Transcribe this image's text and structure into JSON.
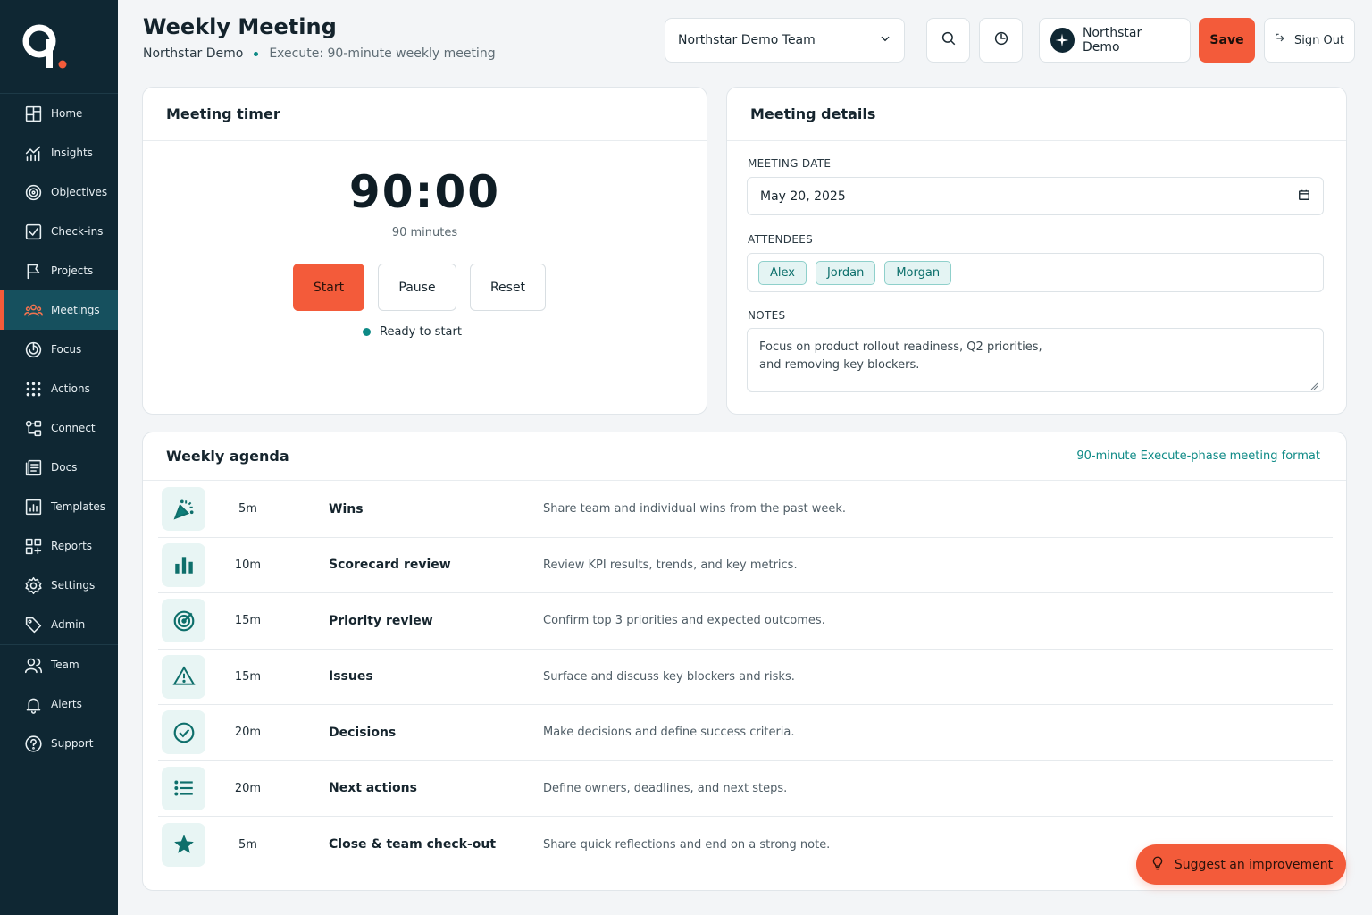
{
  "header": {
    "title": "Weekly Meeting",
    "org": "Northstar Demo",
    "phase": "Execute: 90-minute weekly meeting",
    "team_select": "Northstar Demo Team",
    "org_button": "Northstar Demo",
    "save_label": "Save",
    "signout_label": "Sign Out"
  },
  "sidebar": {
    "items": [
      {
        "label": "Home",
        "icon": "home-icon"
      },
      {
        "label": "Insights",
        "icon": "insights-icon"
      },
      {
        "label": "Objectives",
        "icon": "target-icon"
      },
      {
        "label": "Check-ins",
        "icon": "checkbox-icon"
      },
      {
        "label": "Projects",
        "icon": "flag-icon"
      },
      {
        "label": "Meetings",
        "icon": "people-icon",
        "active": true
      },
      {
        "label": "Focus",
        "icon": "focus-icon"
      },
      {
        "label": "Actions",
        "icon": "grid-icon"
      },
      {
        "label": "Connect",
        "icon": "connect-icon"
      },
      {
        "label": "Docs",
        "icon": "docs-icon"
      },
      {
        "label": "Templates",
        "icon": "templates-icon"
      },
      {
        "label": "Reports",
        "icon": "reports-icon"
      },
      {
        "label": "Settings",
        "icon": "gear-icon"
      },
      {
        "label": "Admin",
        "icon": "tag-icon"
      },
      {
        "label": "Team",
        "icon": "team-icon"
      },
      {
        "label": "Alerts",
        "icon": "bell-icon"
      },
      {
        "label": "Support",
        "icon": "help-icon"
      }
    ]
  },
  "timer": {
    "title": "Meeting timer",
    "display": "90:00",
    "minutes_label": "90 minutes",
    "start": "Start",
    "pause": "Pause",
    "reset": "Reset",
    "status": "Ready to start"
  },
  "details": {
    "title": "Meeting details",
    "date_label": "MEETING DATE",
    "date_value": "May 20, 2025",
    "attendees_label": "ATTENDEES",
    "attendees": [
      "Alex",
      "Jordan",
      "Morgan"
    ],
    "notes_label": "NOTES",
    "notes_line1": "Focus on product rollout readiness, Q2 priorities,",
    "notes_line2": "and removing key blockers."
  },
  "agenda": {
    "title": "Weekly agenda",
    "format_link": "90-minute Execute-phase meeting format",
    "items": [
      {
        "duration": "5m",
        "name": "Wins",
        "desc": "Share team and individual wins from the past week.",
        "icon": "party-icon"
      },
      {
        "duration": "10m",
        "name": "Scorecard review",
        "desc": "Review KPI results, trends, and key metrics.",
        "icon": "bar-chart-icon"
      },
      {
        "duration": "15m",
        "name": "Priority review",
        "desc": "Confirm top 3 priorities and expected outcomes.",
        "icon": "target-icon"
      },
      {
        "duration": "15m",
        "name": "Issues",
        "desc": "Surface and discuss key blockers and risks.",
        "icon": "warning-icon"
      },
      {
        "duration": "20m",
        "name": "Decisions",
        "desc": "Make decisions and define success criteria.",
        "icon": "check-circle-icon"
      },
      {
        "duration": "20m",
        "name": "Next actions",
        "desc": "Define owners, deadlines, and next steps.",
        "icon": "list-icon"
      },
      {
        "duration": "5m",
        "name": "Close & team check-out",
        "desc": "Share quick reflections and end on a strong note.",
        "icon": "star-icon"
      }
    ]
  },
  "suggest_label": "Suggest an improvement",
  "colors": {
    "accent": "#f35b3a",
    "teal": "#0e8a86",
    "sidebar": "#0f2733"
  }
}
